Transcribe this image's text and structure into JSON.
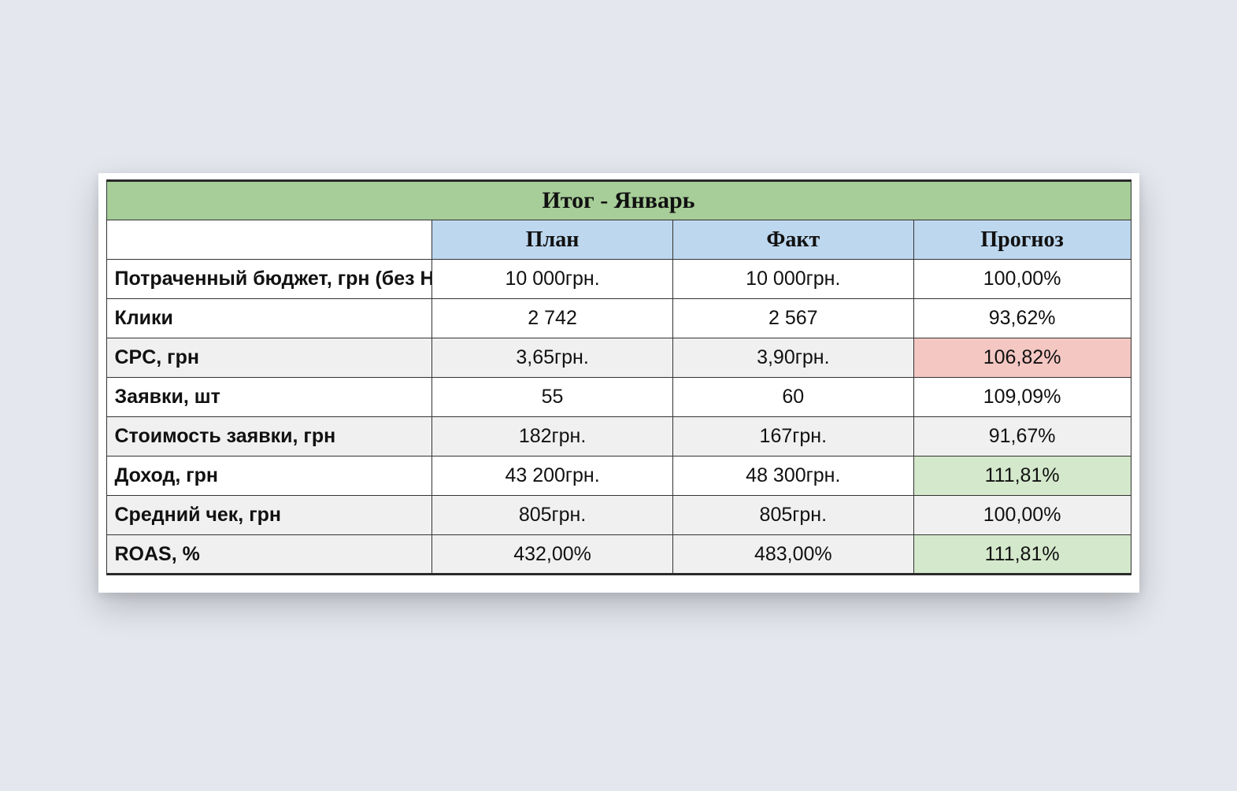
{
  "title": "Итог - Январь",
  "headers": {
    "plan": "План",
    "fact": "Факт",
    "prognoz": "Прогноз"
  },
  "rows": [
    {
      "label": "Потраченный бюджет, грн (без НД",
      "plan": "10 000грн.",
      "fact": "10 000грн.",
      "prognoz": "100,00%",
      "alt": false,
      "prog_class": ""
    },
    {
      "label": "Клики",
      "plan": "2 742",
      "fact": "2 567",
      "prognoz": "93,62%",
      "alt": false,
      "prog_class": ""
    },
    {
      "label": "CPC, грн",
      "plan": "3,65грн.",
      "fact": "3,90грн.",
      "prognoz": "106,82%",
      "alt": true,
      "prog_class": "prog-red"
    },
    {
      "label": "Заявки, шт",
      "plan": "55",
      "fact": "60",
      "prognoz": "109,09%",
      "alt": false,
      "prog_class": ""
    },
    {
      "label": "Стоимость заявки, грн",
      "plan": "182грн.",
      "fact": "167грн.",
      "prognoz": "91,67%",
      "alt": true,
      "prog_class": ""
    },
    {
      "label": "Доход, грн",
      "plan": "43 200грн.",
      "fact": "48 300грн.",
      "prognoz": "111,81%",
      "alt": false,
      "prog_class": "prog-green"
    },
    {
      "label": "Средний чек, грн",
      "plan": "805грн.",
      "fact": "805грн.",
      "prognoz": "100,00%",
      "alt": true,
      "prog_class": ""
    },
    {
      "label": "ROAS, %",
      "plan": "432,00%",
      "fact": "483,00%",
      "prognoz": "111,81%",
      "alt": true,
      "prog_class": "prog-green"
    }
  ],
  "chart_data": {
    "type": "table",
    "title": "Итог - Январь",
    "columns": [
      "",
      "План",
      "Факт",
      "Прогноз"
    ],
    "data": [
      [
        "Потраченный бюджет, грн (без НД",
        "10 000грн.",
        "10 000грн.",
        "100,00%"
      ],
      [
        "Клики",
        "2 742",
        "2 567",
        "93,62%"
      ],
      [
        "CPC, грн",
        "3,65грн.",
        "3,90грн.",
        "106,82%"
      ],
      [
        "Заявки, шт",
        "55",
        "60",
        "109,09%"
      ],
      [
        "Стоимость заявки, грн",
        "182грн.",
        "167грн.",
        "91,67%"
      ],
      [
        "Доход, грн",
        "43 200грн.",
        "48 300грн.",
        "111,81%"
      ],
      [
        "Средний чек, грн",
        "805грн.",
        "805грн.",
        "100,00%"
      ],
      [
        "ROAS, %",
        "432,00%",
        "483,00%",
        "111,81%"
      ]
    ]
  }
}
